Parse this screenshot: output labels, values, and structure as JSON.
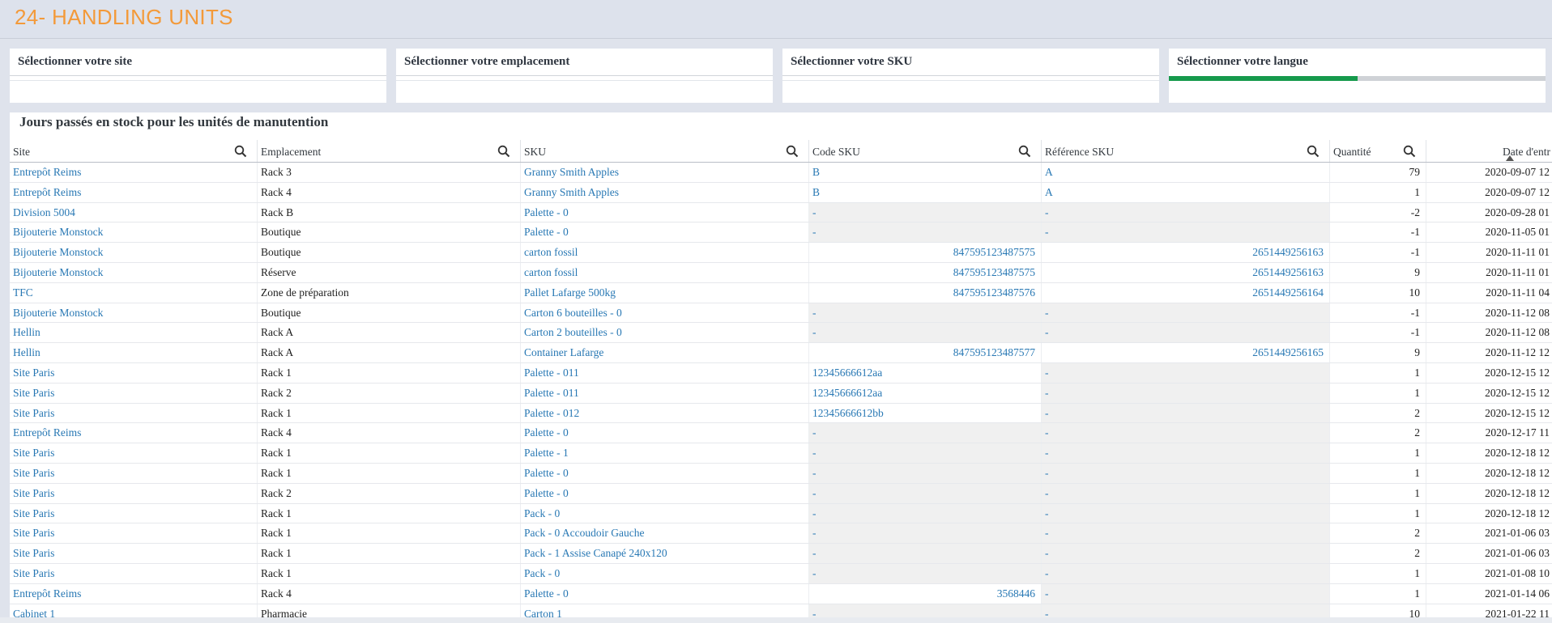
{
  "app": {
    "title": "24- HANDLING UNITS"
  },
  "filters": [
    {
      "label": "Sélectionner votre site"
    },
    {
      "label": "Sélectionner votre emplacement"
    },
    {
      "label": "Sélectionner votre SKU"
    },
    {
      "label": "Sélectionner votre langue",
      "progress": 0.5
    }
  ],
  "table": {
    "title": "Jours passés en stock pour les unités de manutention",
    "columns": [
      "Site",
      "Emplacement",
      "SKU",
      "Code SKU",
      "Référence SKU",
      "Quantité",
      "Date d'entr"
    ],
    "rows": [
      [
        "Entrepôt Reims",
        "Rack 3",
        "Granny Smith Apples",
        "B",
        "A",
        "79",
        "2020-09-07 12"
      ],
      [
        "Entrepôt Reims",
        "Rack 4",
        "Granny Smith Apples",
        "B",
        "A",
        "1",
        "2020-09-07 12"
      ],
      [
        "Division 5004",
        "Rack B",
        "Palette - 0",
        "-",
        "-",
        "-2",
        "2020-09-28 01"
      ],
      [
        "Bijouterie Monstock",
        "Boutique",
        "Palette - 0",
        "-",
        "-",
        "-1",
        "2020-11-05 01"
      ],
      [
        "Bijouterie Monstock",
        "Boutique",
        "carton fossil",
        "847595123487575",
        "2651449256163",
        "-1",
        "2020-11-11 01"
      ],
      [
        "Bijouterie Monstock",
        "Réserve",
        "carton fossil",
        "847595123487575",
        "2651449256163",
        "9",
        "2020-11-11 01"
      ],
      [
        "TFC",
        "Zone de préparation",
        "Pallet Lafarge 500kg",
        "847595123487576",
        "2651449256164",
        "10",
        "2020-11-11 04"
      ],
      [
        "Bijouterie Monstock",
        "Boutique",
        "Carton 6 bouteilles - 0",
        "-",
        "-",
        "-1",
        "2020-11-12 08"
      ],
      [
        "Hellin",
        "Rack A",
        "Carton 2 bouteilles - 0",
        "-",
        "-",
        "-1",
        "2020-11-12 08"
      ],
      [
        "Hellin",
        "Rack A",
        "Container Lafarge",
        "847595123487577",
        "2651449256165",
        "9",
        "2020-11-12 12"
      ],
      [
        "Site Paris",
        "Rack 1",
        "Palette - 011",
        "12345666612aa",
        "-",
        "1",
        "2020-12-15 12"
      ],
      [
        "Site Paris",
        "Rack 2",
        "Palette - 011",
        "12345666612aa",
        "-",
        "1",
        "2020-12-15 12"
      ],
      [
        "Site Paris",
        "Rack 1",
        "Palette - 012",
        "12345666612bb",
        "-",
        "2",
        "2020-12-15 12"
      ],
      [
        "Entrepôt Reims",
        "Rack 4",
        "Palette - 0",
        "-",
        "-",
        "2",
        "2020-12-17 11"
      ],
      [
        "Site Paris",
        "Rack 1",
        "Palette - 1",
        "-",
        "-",
        "1",
        "2020-12-18 12"
      ],
      [
        "Site Paris",
        "Rack 1",
        "Palette - 0",
        "-",
        "-",
        "1",
        "2020-12-18 12"
      ],
      [
        "Site Paris",
        "Rack 2",
        "Palette - 0",
        "-",
        "-",
        "1",
        "2020-12-18 12"
      ],
      [
        "Site Paris",
        "Rack 1",
        "Pack - 0",
        "-",
        "-",
        "1",
        "2020-12-18 12"
      ],
      [
        "Site Paris",
        "Rack 1",
        "Pack - 0 Accoudoir Gauche",
        "-",
        "-",
        "2",
        "2021-01-06 03"
      ],
      [
        "Site Paris",
        "Rack 1",
        "Pack - 1 Assise Canapé 240x120",
        "-",
        "-",
        "2",
        "2021-01-06 03"
      ],
      [
        "Site Paris",
        "Rack 1",
        "Pack - 0",
        "-",
        "-",
        "1",
        "2021-01-08 10"
      ],
      [
        "Entrepôt Reims",
        "Rack 4",
        "Palette - 0",
        "3568446",
        "-",
        "1",
        "2021-01-14 06"
      ],
      [
        "Cabinet 1",
        "Pharmacie",
        "Carton 1",
        "-",
        "-",
        "10",
        "2021-01-22 11"
      ]
    ]
  },
  "icons": {
    "search": "search-icon",
    "sort": "sort-ascending-icon"
  },
  "colors": {
    "title": "#f39a3a",
    "link": "#2878b4",
    "progress": "#169a4c"
  }
}
